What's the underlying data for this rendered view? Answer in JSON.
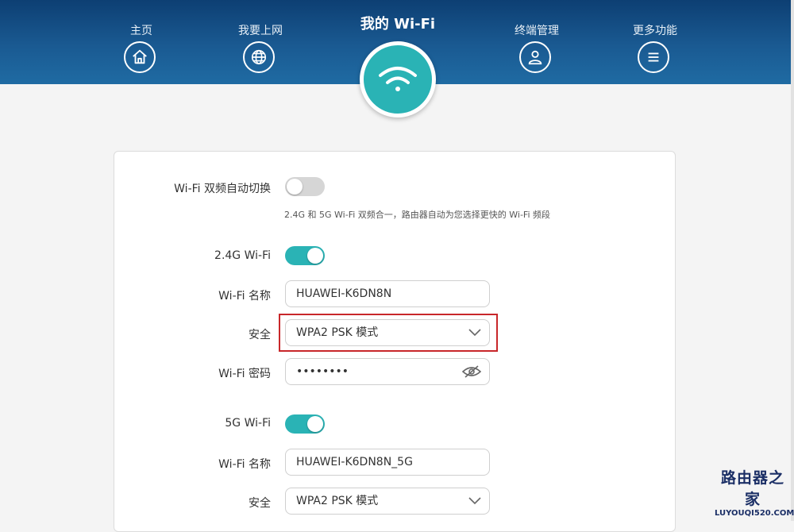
{
  "nav": {
    "items": [
      {
        "label": "主页",
        "icon": "home-icon"
      },
      {
        "label": "我要上网",
        "icon": "globe-icon"
      },
      {
        "label": "终端管理",
        "icon": "user-icon"
      },
      {
        "label": "更多功能",
        "icon": "menu-icon"
      }
    ],
    "active": {
      "label": "我的 Wi-Fi",
      "icon": "wifi-icon"
    }
  },
  "settings": {
    "dual_band": {
      "label": "Wi-Fi 双频自动切换",
      "enabled": false,
      "hint": "2.4G 和 5G Wi-Fi 双频合一，路由器自动为您选择更快的 Wi-Fi 频段"
    },
    "band24": {
      "label": "2.4G Wi-Fi",
      "enabled": true,
      "name_label": "Wi-Fi 名称",
      "name_value": "HUAWEI-K6DN8N",
      "security_label": "安全",
      "security_value": "WPA2 PSK 模式",
      "password_label": "Wi-Fi 密码",
      "password_value": "••••••••"
    },
    "band5": {
      "label": "5G Wi-Fi",
      "enabled": true,
      "name_label": "Wi-Fi 名称",
      "name_value": "HUAWEI-K6DN8N_5G",
      "security_label": "安全",
      "security_value": "WPA2 PSK 模式"
    }
  },
  "watermark": {
    "text": "路由器之家",
    "url": "LUYOUQI520.COM"
  },
  "colors": {
    "header": "#1a5a92",
    "accent": "#2ab3b5",
    "highlight": "#c8272a"
  }
}
